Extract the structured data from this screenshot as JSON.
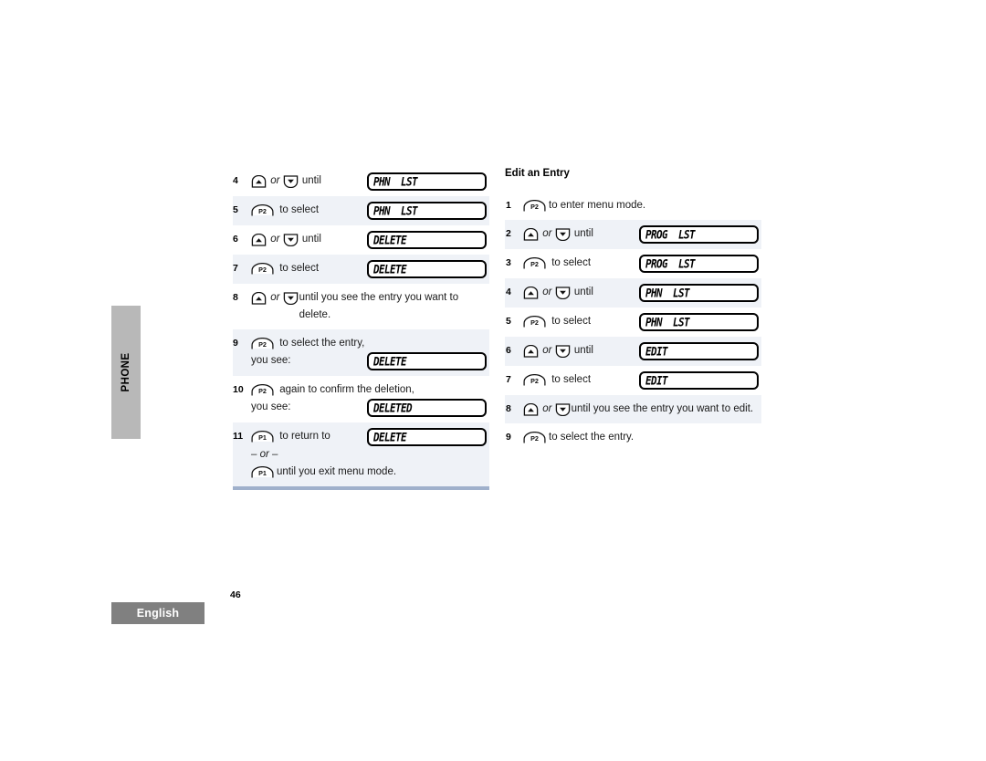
{
  "side_tab": {
    "label": "PHONE"
  },
  "footer": {
    "language": "English",
    "page_number": "46"
  },
  "icons": {
    "up": "up-arrow-key-icon",
    "down": "down-arrow-key-icon",
    "p1": "p1-key-icon",
    "p2": "p2-key-icon"
  },
  "key_labels": {
    "p1": "P1",
    "p2": "P2"
  },
  "left_column": {
    "rows": [
      {
        "num": "4",
        "before": "",
        "keys": "updown",
        "after": " until",
        "lcd": "PHN  LST"
      },
      {
        "num": "5",
        "before": "",
        "keys": "p2",
        "after": " to select",
        "lcd": "PHN  LST"
      },
      {
        "num": "6",
        "before": "",
        "keys": "updown",
        "after": " until",
        "lcd": "DELETE"
      },
      {
        "num": "7",
        "before": "",
        "keys": "p2",
        "after": " to select",
        "lcd": "DELETE"
      },
      {
        "num": "8",
        "before": "",
        "keys": "updown",
        "after": " until you see the entry you want to delete.",
        "lcd": ""
      },
      {
        "num": "9",
        "before": "",
        "keys": "p2",
        "after": " to select the entry,",
        "sub_label": "you see:",
        "lcd": "DELETE"
      },
      {
        "num": "10",
        "before": "",
        "keys": "p2",
        "after": " again to confirm the deletion,",
        "sub_label": "you see:",
        "lcd": "DELETED"
      },
      {
        "num": "11",
        "before": "",
        "keys": "p1",
        "after": " to return to",
        "lcd": "DELETE",
        "or_text": "– or –",
        "tail_keys": "p1",
        "tail_text": " until you exit menu mode."
      }
    ]
  },
  "right_column": {
    "heading": "Edit an Entry",
    "rows": [
      {
        "num": "1",
        "keys": "p2",
        "after": " to enter menu mode.",
        "lcd": ""
      },
      {
        "num": "2",
        "keys": "updown",
        "after": " until",
        "lcd": "PROG  LST"
      },
      {
        "num": "3",
        "keys": "p2",
        "after": " to select",
        "lcd": "PROG  LST"
      },
      {
        "num": "4",
        "keys": "updown",
        "after": " until",
        "lcd": "PHN  LST"
      },
      {
        "num": "5",
        "keys": "p2",
        "after": " to select",
        "lcd": "PHN  LST"
      },
      {
        "num": "6",
        "keys": "updown",
        "after": " until",
        "lcd": "EDIT"
      },
      {
        "num": "7",
        "keys": "p2",
        "after": " to select",
        "lcd": "EDIT"
      },
      {
        "num": "8",
        "keys": "updown",
        "after": " until you see the entry you want to edit.",
        "lcd": ""
      },
      {
        "num": "9",
        "keys": "p2",
        "after": " to select the entry.",
        "lcd": ""
      }
    ]
  },
  "connectors": {
    "or": "or"
  }
}
